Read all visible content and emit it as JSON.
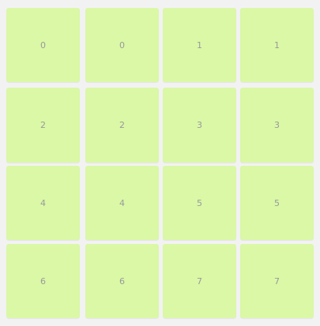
{
  "colors": {
    "background": "#f3f2f3",
    "card": "#daf8a6",
    "text": "#9a9a9a"
  },
  "board": {
    "cards": [
      {
        "label": "0"
      },
      {
        "label": "0"
      },
      {
        "label": "1"
      },
      {
        "label": "1"
      },
      {
        "label": "2"
      },
      {
        "label": "2"
      },
      {
        "label": "3"
      },
      {
        "label": "3"
      },
      {
        "label": "4"
      },
      {
        "label": "4"
      },
      {
        "label": "5"
      },
      {
        "label": "5"
      },
      {
        "label": "6"
      },
      {
        "label": "6"
      },
      {
        "label": "7"
      },
      {
        "label": "7"
      }
    ]
  }
}
